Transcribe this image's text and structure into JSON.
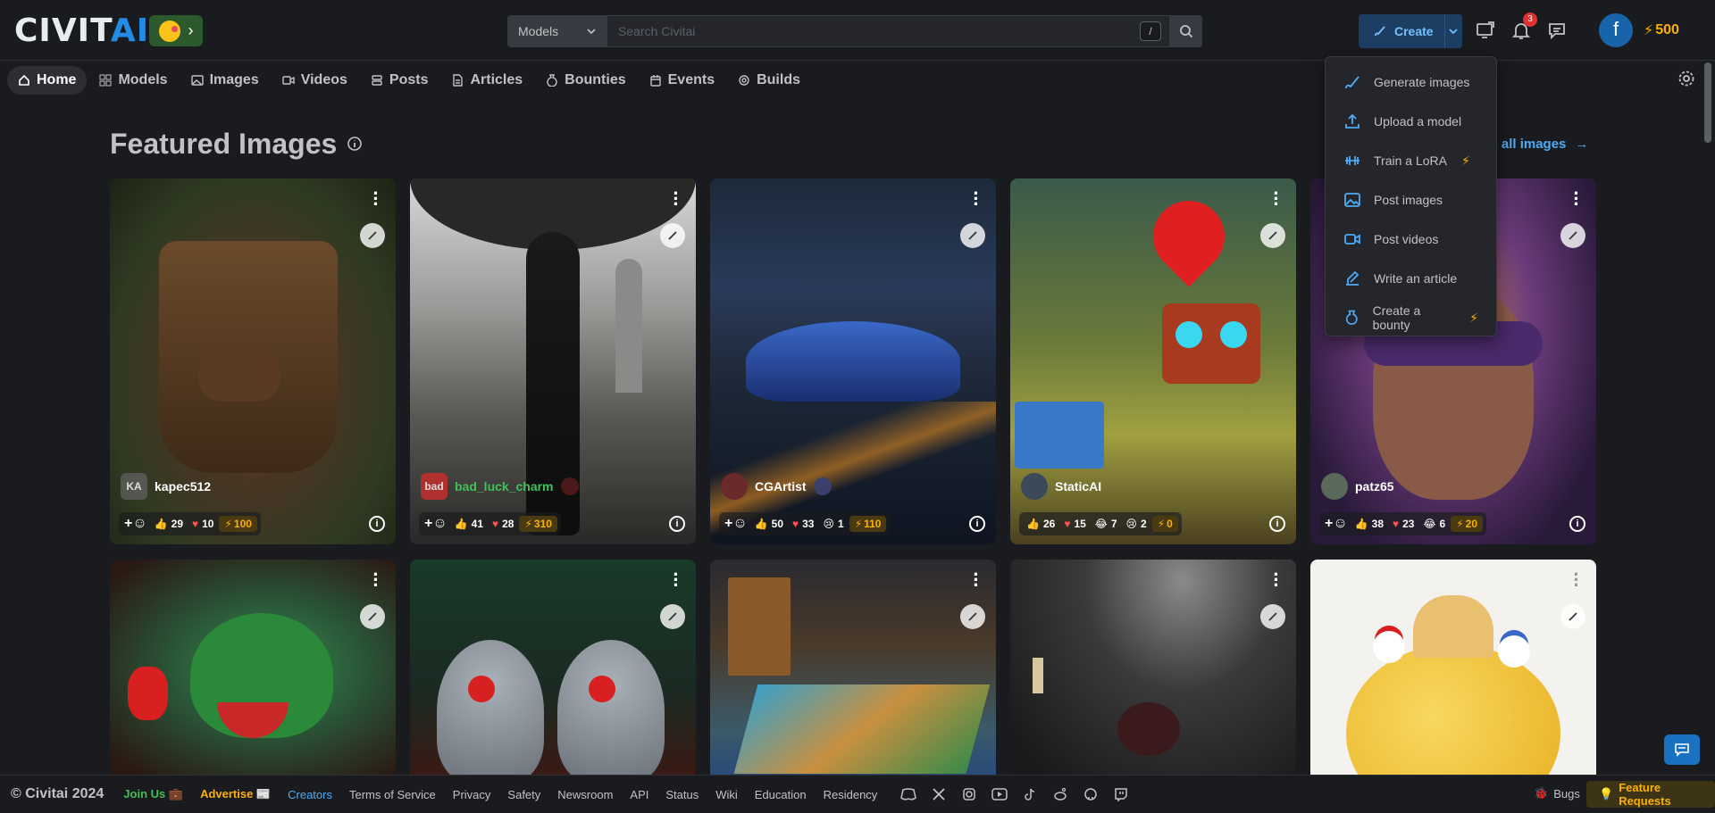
{
  "brand": {
    "logo_civ": "CIVIT",
    "logo_ai": "AI"
  },
  "search": {
    "scope": "Models",
    "placeholder": "Search Civitai",
    "shortcut": "/"
  },
  "header": {
    "create_label": "Create",
    "notifications_count": "3",
    "user_initial": "f",
    "buzz_amount": "500"
  },
  "nav": {
    "items": [
      {
        "label": "Home",
        "icon": "home-icon"
      },
      {
        "label": "Models",
        "icon": "grid-icon"
      },
      {
        "label": "Images",
        "icon": "image-icon"
      },
      {
        "label": "Videos",
        "icon": "video-icon"
      },
      {
        "label": "Posts",
        "icon": "posts-icon"
      },
      {
        "label": "Articles",
        "icon": "article-icon"
      },
      {
        "label": "Bounties",
        "icon": "bounty-icon"
      },
      {
        "label": "Events",
        "icon": "calendar-icon"
      },
      {
        "label": "Builds",
        "icon": "cpu-icon"
      }
    ]
  },
  "main": {
    "title": "Featured Images",
    "see_all": "See all images"
  },
  "create_menu": {
    "items": [
      {
        "label": "Generate images",
        "icon": "brush-icon"
      },
      {
        "label": "Upload a model",
        "icon": "upload-icon"
      },
      {
        "label": "Train a LoRA",
        "icon": "barbell-icon",
        "buzz": true
      },
      {
        "label": "Post images",
        "icon": "photo-icon"
      },
      {
        "label": "Post videos",
        "icon": "video-icon"
      },
      {
        "label": "Write an article",
        "icon": "pencil-icon"
      },
      {
        "label": "Create a bounty",
        "icon": "bounty-icon",
        "buzz": true
      }
    ]
  },
  "cards": [
    {
      "user": "kapec512",
      "avatar": "KA",
      "reactions": {
        "like": "29",
        "heart": "10"
      },
      "tip": "100"
    },
    {
      "user": "bad_luck_charm",
      "avatar": "bad",
      "reactions": {
        "like": "41",
        "heart": "28"
      },
      "tip": "310"
    },
    {
      "user": "CGArtist",
      "avatar": "",
      "reactions": {
        "like": "50",
        "heart": "33",
        "cry": "1"
      },
      "tip": "110"
    },
    {
      "user": "StaticAI",
      "avatar": "",
      "reactions": {
        "like": "26",
        "heart": "15",
        "laugh": "7",
        "cry": "2"
      },
      "tip": "0"
    },
    {
      "user": "patz65",
      "avatar": "",
      "reactions": {
        "like": "38",
        "heart": "23",
        "laugh": "6"
      },
      "tip": "20"
    }
  ],
  "footer": {
    "copyright": "© Civitai 2024",
    "links": [
      "Join Us 💼",
      "Advertise 📰",
      "Creators",
      "Terms of Service",
      "Privacy",
      "Safety",
      "Newsroom",
      "API",
      "Status",
      "Wiki",
      "Education",
      "Residency"
    ],
    "bugs": "Bugs",
    "feature_requests": "Feature Requests"
  },
  "colors": {
    "accent": "#228be6",
    "buzz": "#fab005",
    "bg": "#1a1b1e"
  }
}
